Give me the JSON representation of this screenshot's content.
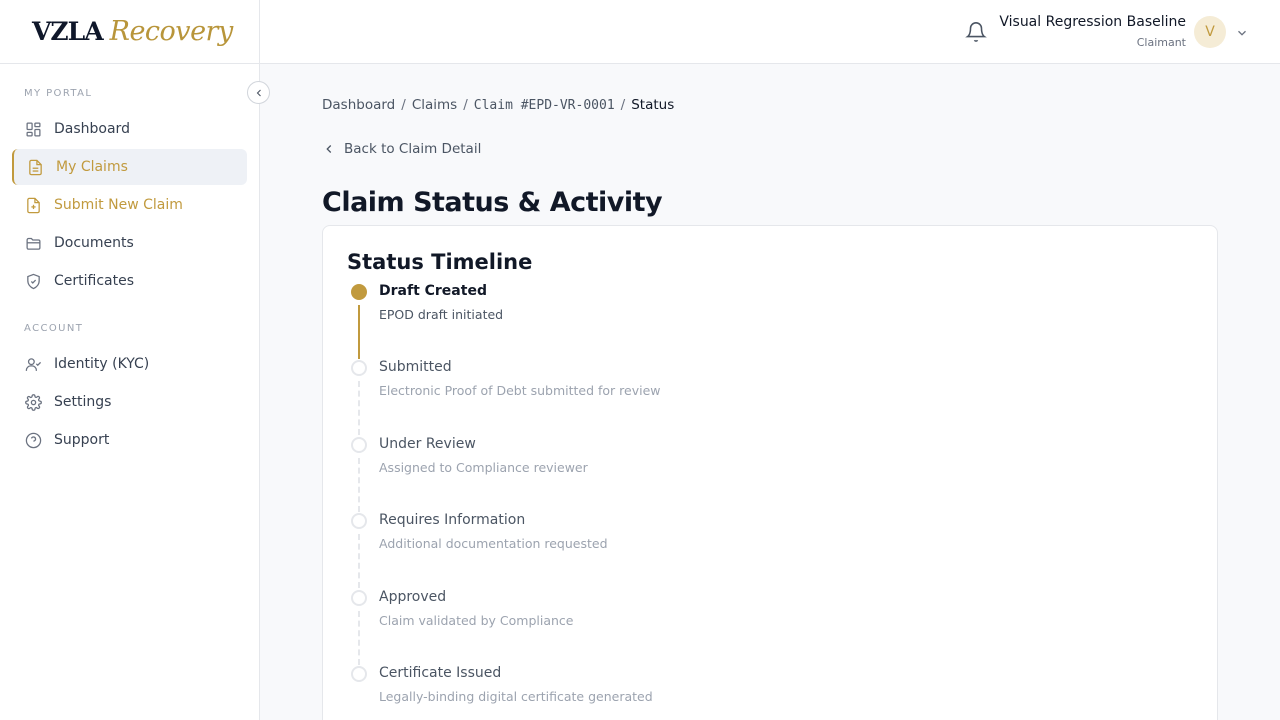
{
  "brand": {
    "part1": "VZLA",
    "part2": "Recovery"
  },
  "sidebar": {
    "section_portal": "MY PORTAL",
    "section_account": "ACCOUNT",
    "items": [
      {
        "label": "Dashboard",
        "icon": "grid-icon"
      },
      {
        "label": "My Claims",
        "icon": "document-icon",
        "active": true
      },
      {
        "label": "Submit New Claim",
        "icon": "file-plus-icon"
      },
      {
        "label": "Documents",
        "icon": "folder-icon"
      },
      {
        "label": "Certificates",
        "icon": "shield-check-icon"
      },
      {
        "label": "Identity (KYC)",
        "icon": "user-check-icon"
      },
      {
        "label": "Settings",
        "icon": "gear-icon"
      },
      {
        "label": "Support",
        "icon": "help-circle-icon"
      }
    ]
  },
  "header": {
    "user_name": "Visual Regression Baseline",
    "user_role": "Claimant",
    "avatar_initial": "V"
  },
  "breadcrumb": {
    "items": [
      "Dashboard",
      "Claims",
      "Claim #EPD-VR-0001",
      "Status"
    ]
  },
  "back_link": "Back to Claim Detail",
  "page_title": "Claim Status & Activity",
  "timeline": {
    "title": "Status Timeline",
    "steps": [
      {
        "label": "Draft Created",
        "desc": "EPOD draft initiated",
        "done": true
      },
      {
        "label": "Submitted",
        "desc": "Electronic Proof of Debt submitted for review",
        "done": false
      },
      {
        "label": "Under Review",
        "desc": "Assigned to Compliance reviewer",
        "done": false
      },
      {
        "label": "Requires Information",
        "desc": "Additional documentation requested",
        "done": false
      },
      {
        "label": "Approved",
        "desc": "Claim validated by Compliance",
        "done": false
      },
      {
        "label": "Certificate Issued",
        "desc": "Legally-binding digital certificate generated",
        "done": false
      }
    ]
  },
  "colors": {
    "accent": "#c19a3e",
    "navy": "#0f172a",
    "muted": "#9ca3af"
  }
}
